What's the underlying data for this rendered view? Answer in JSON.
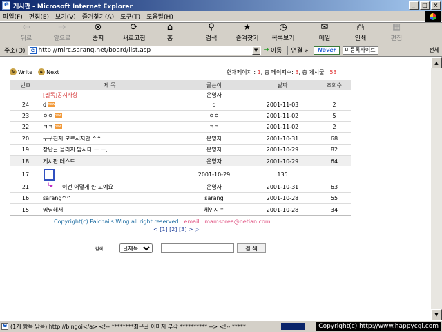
{
  "window": {
    "title": "게시판 - Microsoft Internet Explorer"
  },
  "menu": [
    "파일(F)",
    "편집(E)",
    "보기(V)",
    "즐겨찾기(A)",
    "도구(T)",
    "도움말(H)"
  ],
  "toolbar": {
    "back": "뒤로",
    "forward": "앞으로",
    "stop": "중지",
    "refresh": "새로고침",
    "home": "홈",
    "search": "검색",
    "favorites": "즐겨찾기",
    "history": "목록보기",
    "mail": "메일",
    "print": "인쇄",
    "edit": "편집"
  },
  "address": {
    "label": "주소(D)",
    "url": "http://mirc.sarang.net/board/list.asp",
    "go": "이동",
    "links": "연결 »",
    "naver": "Naver",
    "sites": "미등록사이트",
    "all": "전체"
  },
  "board": {
    "write": "Write",
    "next": "Next",
    "info": {
      "prefix": "현재페이지 : ",
      "current": "1",
      "mid": ", 총 페이지수: ",
      "pages": "3",
      "mid2": ", 총 게시물 : ",
      "total": "53"
    },
    "headers": {
      "num": "번호",
      "subject": "제 목",
      "author": "글쓴이",
      "date": "날짜",
      "views": "조회수"
    },
    "notice": {
      "subject": "[필독]공지사항",
      "author": "운영자"
    },
    "rows": [
      {
        "num": "24",
        "subject": "d",
        "author": "d",
        "date": "2001-11-03",
        "views": "2",
        "badge": "new"
      },
      {
        "num": "23",
        "subject": "ㅇㅇ",
        "author": "ㅇㅇ",
        "date": "2001-11-02",
        "views": "5",
        "badge": "new"
      },
      {
        "num": "22",
        "subject": "ㅋㅋ",
        "author": "ㅋㅋ",
        "date": "2001-11-02",
        "views": "2",
        "badge": "new"
      },
      {
        "num": "20",
        "subject": "누구진지 모르시지만 ^^",
        "author": "운영자",
        "date": "2001-10-31",
        "views": "68"
      },
      {
        "num": "19",
        "subject": "장난글 올리지 맙시다 ㅡ.ㅡ;",
        "author": "운영자",
        "date": "2001-10-29",
        "views": "82"
      },
      {
        "num": "18",
        "subject": "게시판 테스트",
        "author": "운영자",
        "date": "2001-10-29",
        "views": "64"
      },
      {
        "num": "17",
        "subject": "...",
        "author": "2001-10-29",
        "date": "135",
        "views": ""
      },
      {
        "num": "21",
        "subject": "이건 어떻게 한 고예요",
        "author": "운영자",
        "date": "2001-10-31",
        "views": "63"
      },
      {
        "num": "16",
        "subject": "sarang^^",
        "author": "sarang",
        "date": "2001-10-28",
        "views": "55"
      },
      {
        "num": "15",
        "subject": "띵띵해서",
        "author": "체인지™",
        "date": "2001-10-28",
        "views": "34"
      }
    ],
    "copyright": "Copyright(c) Paichai's Wing all right reserved",
    "email": "email : mamsorea@netian.com",
    "pager": "< [1] [2] [3] > ▷",
    "search_label": "검색",
    "search_select": "글제목",
    "search_button": "검 색"
  },
  "status": {
    "text": "(1개 항목 남음) http://bingoi</a> <!-- ********최근글 이미지 부각 ********** -->  <!-- *****",
    "right": "Copyright(c) http://www.happycgi.com"
  }
}
